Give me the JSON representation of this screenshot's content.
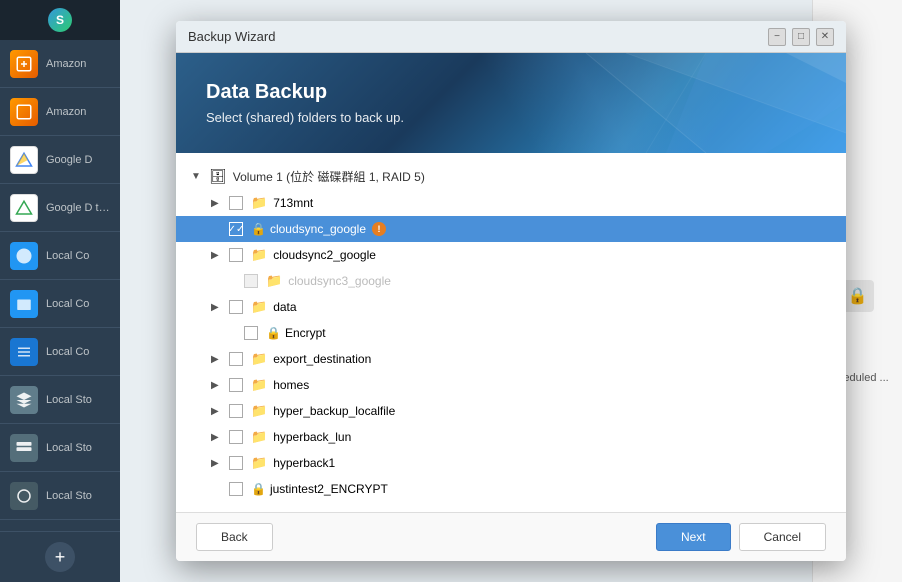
{
  "window": {
    "title": "Backup Wizard",
    "controls": {
      "minimize": "−",
      "maximize": "□",
      "close": "✕"
    }
  },
  "sidebar": {
    "items": [
      {
        "label": "Amazon",
        "icon": "amazon-icon",
        "color": "#FF9900"
      },
      {
        "label": "Amazon",
        "icon": "amazon-icon",
        "color": "#FF9900"
      },
      {
        "label": "Google D",
        "icon": "googledrive-icon",
        "color": "#4285F4"
      },
      {
        "label": "Google D test",
        "icon": "googledrive-icon",
        "color": "#34A853"
      },
      {
        "label": "Local Co",
        "icon": "backup-icon",
        "color": "#2196F3"
      },
      {
        "label": "Local Co",
        "icon": "backup-icon",
        "color": "#2196F3"
      },
      {
        "label": "Local Co",
        "icon": "backup-icon",
        "color": "#2196F3"
      },
      {
        "label": "Local Sto",
        "icon": "storage-icon",
        "color": "#607D8B"
      },
      {
        "label": "Local Sto",
        "icon": "storage-icon",
        "color": "#607D8B"
      },
      {
        "label": "Local Sto",
        "icon": "storage-icon",
        "color": "#607D8B"
      }
    ],
    "add_button": "+"
  },
  "header": {
    "title": "Data Backup",
    "subtitle": "Select (shared) folders to back up."
  },
  "right_panel": {
    "scheduled_label": "scheduled ..."
  },
  "tree": {
    "volume": {
      "label": "Volume 1 (位於 磁碟群組 1, RAID 5)",
      "expanded": true
    },
    "items": [
      {
        "id": "713mnt",
        "name": "713mnt",
        "level": 1,
        "expand": true,
        "checked": false,
        "disabled": false,
        "lock": false,
        "warn": false
      },
      {
        "id": "cloudsync_google",
        "name": "cloudsync_google",
        "level": 1,
        "expand": false,
        "checked": true,
        "disabled": false,
        "lock": true,
        "warn": true,
        "selected": true
      },
      {
        "id": "cloudsync2_google",
        "name": "cloudsync2_google",
        "level": 1,
        "expand": true,
        "checked": false,
        "disabled": false,
        "lock": false,
        "warn": false
      },
      {
        "id": "cloudsync3_google",
        "name": "cloudsync3_google",
        "level": 2,
        "expand": false,
        "checked": false,
        "disabled": true,
        "lock": false,
        "warn": false
      },
      {
        "id": "data",
        "name": "data",
        "level": 1,
        "expand": true,
        "checked": false,
        "disabled": false,
        "lock": false,
        "warn": false
      },
      {
        "id": "encrypt",
        "name": "Encrypt",
        "level": 2,
        "expand": false,
        "checked": false,
        "disabled": false,
        "lock": true,
        "warn": false
      },
      {
        "id": "export_destination",
        "name": "export_destination",
        "level": 1,
        "expand": true,
        "checked": false,
        "disabled": false,
        "lock": false,
        "warn": false
      },
      {
        "id": "homes",
        "name": "homes",
        "level": 1,
        "expand": true,
        "checked": false,
        "disabled": false,
        "lock": false,
        "warn": false
      },
      {
        "id": "hyper_backup_localfile",
        "name": "hyper_backup_localfile",
        "level": 1,
        "expand": true,
        "checked": false,
        "disabled": false,
        "lock": false,
        "warn": false
      },
      {
        "id": "hyperback_lun",
        "name": "hyperback_lun",
        "level": 1,
        "expand": true,
        "checked": false,
        "disabled": false,
        "lock": false,
        "warn": false
      },
      {
        "id": "hyperback1",
        "name": "hyperback1",
        "level": 1,
        "expand": true,
        "checked": false,
        "disabled": false,
        "lock": false,
        "warn": false
      },
      {
        "id": "justintest2_encrypt",
        "name": "justintest2_ENCRYPT",
        "level": 1,
        "expand": false,
        "checked": false,
        "disabled": false,
        "lock": true,
        "warn": false
      }
    ]
  },
  "footer": {
    "back_label": "Back",
    "next_label": "Next",
    "cancel_label": "Cancel"
  }
}
